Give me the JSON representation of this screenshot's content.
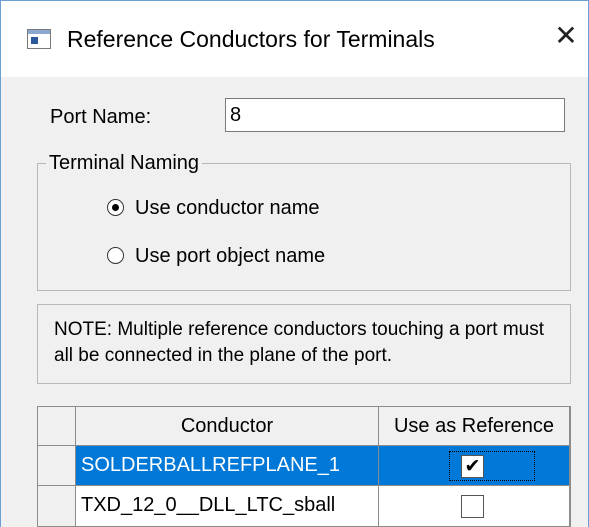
{
  "window": {
    "title": "Reference Conductors for Terminals",
    "close_glyph": "✕"
  },
  "port_name": {
    "label": "Port Name:",
    "value": "8"
  },
  "terminal_naming": {
    "legend": "Terminal Naming",
    "options": [
      {
        "label": "Use conductor name",
        "selected": true
      },
      {
        "label": "Use port object name",
        "selected": false
      }
    ]
  },
  "note": "NOTE: Multiple reference conductors touching a port must all be connected in the plane of the port.",
  "table": {
    "headers": [
      "Conductor",
      "Use as Reference"
    ],
    "rows": [
      {
        "conductor": "SOLDERBALLREFPLANE_1",
        "use_as_reference": true,
        "selected": true,
        "check_glyph": "✔"
      },
      {
        "conductor": "TXD_12_0__DLL_LTC_sball",
        "use_as_reference": false,
        "selected": false,
        "check_glyph": ""
      }
    ]
  },
  "colors": {
    "selection": "#0078d7",
    "window_border": "#6c9fd4",
    "dialog_bg": "#f0f0f0"
  },
  "icons": [
    "app-window-icon",
    "close-icon",
    "checkmark-icon"
  ]
}
